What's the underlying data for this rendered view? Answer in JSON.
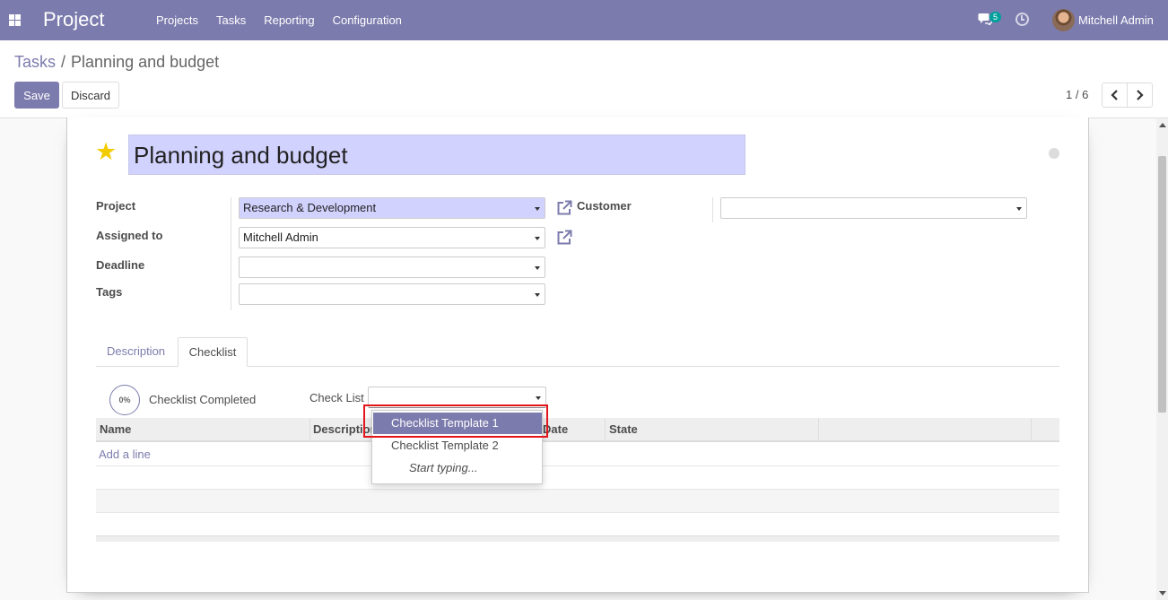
{
  "navbar": {
    "brand": "Project",
    "menu": [
      "Projects",
      "Tasks",
      "Reporting",
      "Configuration"
    ],
    "messages_count": "5",
    "user_name": "Mitchell Admin"
  },
  "breadcrumb": {
    "parent": "Tasks",
    "separator": "/",
    "current": "Planning and budget"
  },
  "buttons": {
    "save": "Save",
    "discard": "Discard"
  },
  "pager": {
    "value": "1 / 6"
  },
  "form": {
    "title": "Planning and budget",
    "fields": {
      "project_label": "Project",
      "project_value": "Research & Development",
      "assigned_label": "Assigned to",
      "assigned_value": "Mitchell Admin",
      "deadline_label": "Deadline",
      "deadline_value": "",
      "tags_label": "Tags",
      "tags_value": "",
      "customer_label": "Customer",
      "customer_value": ""
    },
    "tabs": [
      "Description",
      "Checklist"
    ],
    "checklist": {
      "progress": "0%",
      "progress_label": "Checklist Completed",
      "select_label": "Check List",
      "columns": [
        "Name",
        "Description",
        "Date",
        "State"
      ],
      "add_line": "Add a line"
    }
  },
  "dropdown": {
    "items": [
      "Checklist Template 1",
      "Checklist Template 2"
    ],
    "hint": "Start typing..."
  },
  "colors": {
    "brand": "#7c7bad",
    "required_bg": "#d2d2ff",
    "star": "#f3cc00",
    "highlight": "#e3141a"
  }
}
